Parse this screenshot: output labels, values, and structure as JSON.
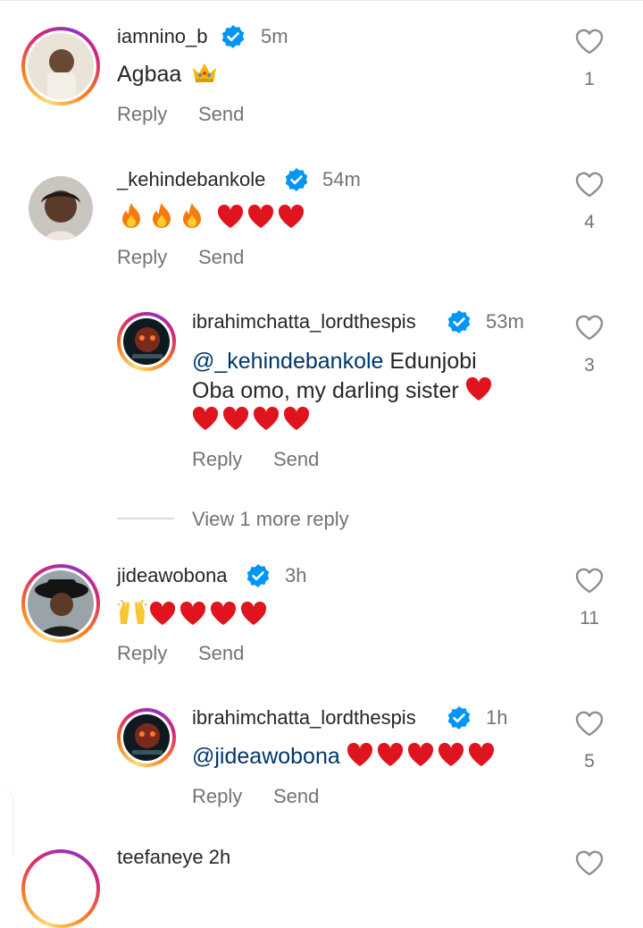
{
  "comments": [
    {
      "username": "iamnino_b",
      "time": "5m",
      "text": "Agbaa",
      "likes": "1"
    },
    {
      "username": "_kehindebankole",
      "time": "54m",
      "likes": "4"
    },
    {
      "username": "ibrahimchatta_lordthespis",
      "time": "53m",
      "mention": "@_kehindebankole",
      "text1": " Edunjobi",
      "text2": "Oba omo, my darling sister",
      "likes": "3"
    },
    {
      "username": "jideawobona",
      "time": "3h",
      "likes": "11"
    },
    {
      "username": "ibrahimchatta_lordthespis",
      "time": "1h",
      "mention": "@jideawobona",
      "likes": "5"
    }
  ],
  "actions": {
    "reply": "Reply",
    "send": "Send"
  },
  "view_more": "View 1 more reply",
  "partial_username": "teefaneye 2h",
  "colors": {
    "heart_red": "#e0141f",
    "verified_blue": "#0095f6",
    "secondary": "#737373",
    "mention": "#00376b"
  },
  "icons": [
    "heart-outline-icon",
    "verified-badge-icon",
    "crown-emoji",
    "fire-emoji",
    "red-heart-emoji",
    "raised-hands-emoji"
  ]
}
